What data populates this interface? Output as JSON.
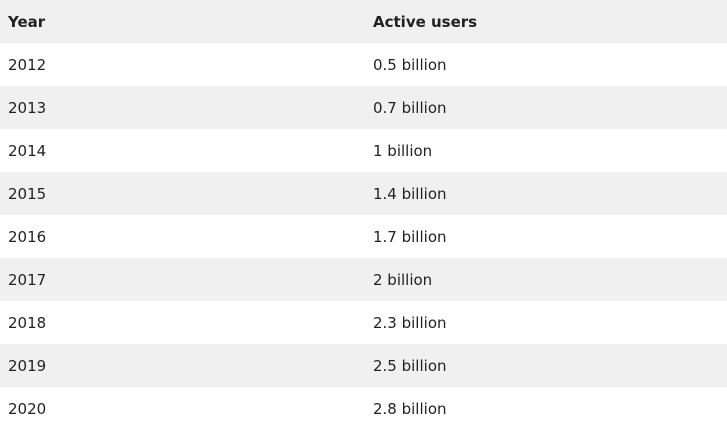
{
  "table": {
    "headers": [
      "Year",
      "Active users"
    ],
    "rows": [
      [
        "2012",
        "0.5 billion"
      ],
      [
        "2013",
        "0.7 billion"
      ],
      [
        "2014",
        "1 billion"
      ],
      [
        "2015",
        "1.4 billion"
      ],
      [
        "2016",
        "1.7 billion"
      ],
      [
        "2017",
        "2 billion"
      ],
      [
        "2018",
        "2.3 billion"
      ],
      [
        "2019",
        "2.5 billion"
      ],
      [
        "2020",
        "2.8 billion"
      ]
    ]
  },
  "colors": {
    "header_bg": "#f0f0f0",
    "stripe_bg": "#f0f0f0",
    "row_bg": "#ffffff",
    "text": "#222222"
  }
}
